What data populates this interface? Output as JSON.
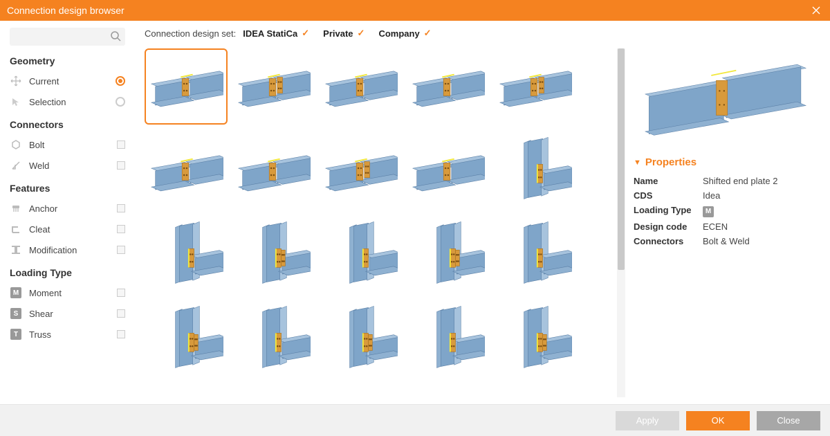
{
  "title": "Connection design browser",
  "search": {
    "placeholder": ""
  },
  "sidebar": {
    "sections": {
      "geometry": {
        "title": "Geometry",
        "items": [
          {
            "label": "Current",
            "checked": true,
            "type": "radio"
          },
          {
            "label": "Selection",
            "checked": false,
            "type": "radio"
          }
        ]
      },
      "connectors": {
        "title": "Connectors",
        "items": [
          {
            "label": "Bolt"
          },
          {
            "label": "Weld"
          }
        ]
      },
      "features": {
        "title": "Features",
        "items": [
          {
            "label": "Anchor"
          },
          {
            "label": "Cleat"
          },
          {
            "label": "Modification"
          }
        ]
      },
      "loadingType": {
        "title": "Loading Type",
        "items": [
          {
            "label": "Moment",
            "badge": "M"
          },
          {
            "label": "Shear",
            "badge": "S"
          },
          {
            "label": "Truss",
            "badge": "T"
          }
        ]
      }
    }
  },
  "filterbar": {
    "label": "Connection design set:",
    "sets": [
      {
        "name": "IDEA StatiCa",
        "checked": true
      },
      {
        "name": "Private",
        "checked": true
      },
      {
        "name": "Company",
        "checked": true
      }
    ]
  },
  "gallery": {
    "selectedIndex": 0,
    "count": 20
  },
  "properties": {
    "header": "Properties",
    "rows": {
      "name": {
        "key": "Name",
        "val": "Shifted end plate 2"
      },
      "cds": {
        "key": "CDS",
        "val": "Idea"
      },
      "loadingType": {
        "key": "Loading Type",
        "badge": "M"
      },
      "designCode": {
        "key": "Design code",
        "val": "ECEN"
      },
      "connectors": {
        "key": "Connectors",
        "val": "Bolt & Weld"
      }
    }
  },
  "footer": {
    "apply": "Apply",
    "ok": "OK",
    "close": "Close"
  }
}
